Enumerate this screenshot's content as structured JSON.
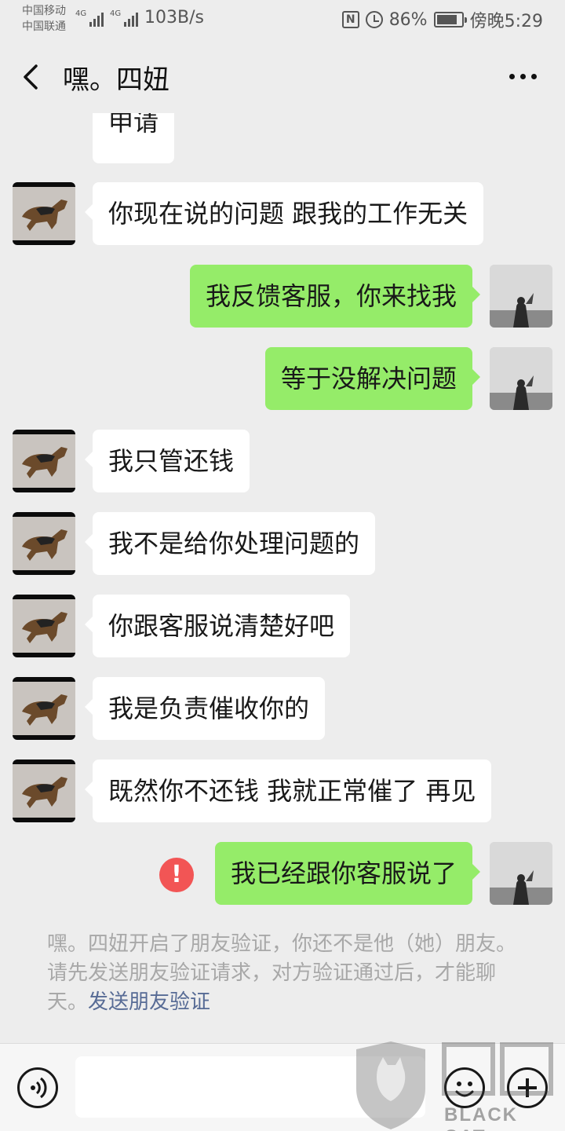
{
  "status_bar": {
    "carrier_1": "中国移动",
    "carrier_2": "中国联通",
    "network_1": "4G",
    "network_2": "4G",
    "net_speed": "103B/s",
    "nfc_label": "N",
    "battery_percent": "86%",
    "battery_level": 0.86,
    "time": "傍晚5:29"
  },
  "header": {
    "title": "嘿。四妞",
    "back_icon": "chevron-left-icon",
    "more_icon": "more-icon"
  },
  "messages": [
    {
      "side": "in",
      "text": "申请"
    },
    {
      "side": "in",
      "text": "你现在说的问题 跟我的工作无关"
    },
    {
      "side": "out",
      "text": "我反馈客服，你来找我"
    },
    {
      "side": "out",
      "text": "等于没解决问题"
    },
    {
      "side": "in",
      "text": "我只管还钱"
    },
    {
      "side": "in",
      "text": "我不是给你处理问题的"
    },
    {
      "side": "in",
      "text": "你跟客服说清楚好吧"
    },
    {
      "side": "in",
      "text": "我是负责催收你的"
    },
    {
      "side": "in",
      "text": "既然你不还钱 我就正常催了 再见"
    },
    {
      "side": "out",
      "text": "我已经跟你客服说了",
      "failed": true,
      "error_symbol": "!"
    }
  ],
  "system_notice": {
    "text": "嘿。四妞开启了朋友验证，你还不是他（她）朋友。请先发送朋友验证请求，对方验证通过后，才能聊天。",
    "link": "发送朋友验证"
  },
  "input_bar": {
    "voice_icon": "voice-icon",
    "emoji_icon": "emoji-icon",
    "plus_icon": "plus-icon",
    "placeholder": ""
  },
  "watermark": {
    "text": "BLACK CAT",
    "logo_text": "黑猫"
  },
  "colors": {
    "background": "#ededed",
    "outgoing_bubble": "#95ec69",
    "incoming_bubble": "#ffffff",
    "link": "#576b95",
    "error": "#f25555"
  }
}
